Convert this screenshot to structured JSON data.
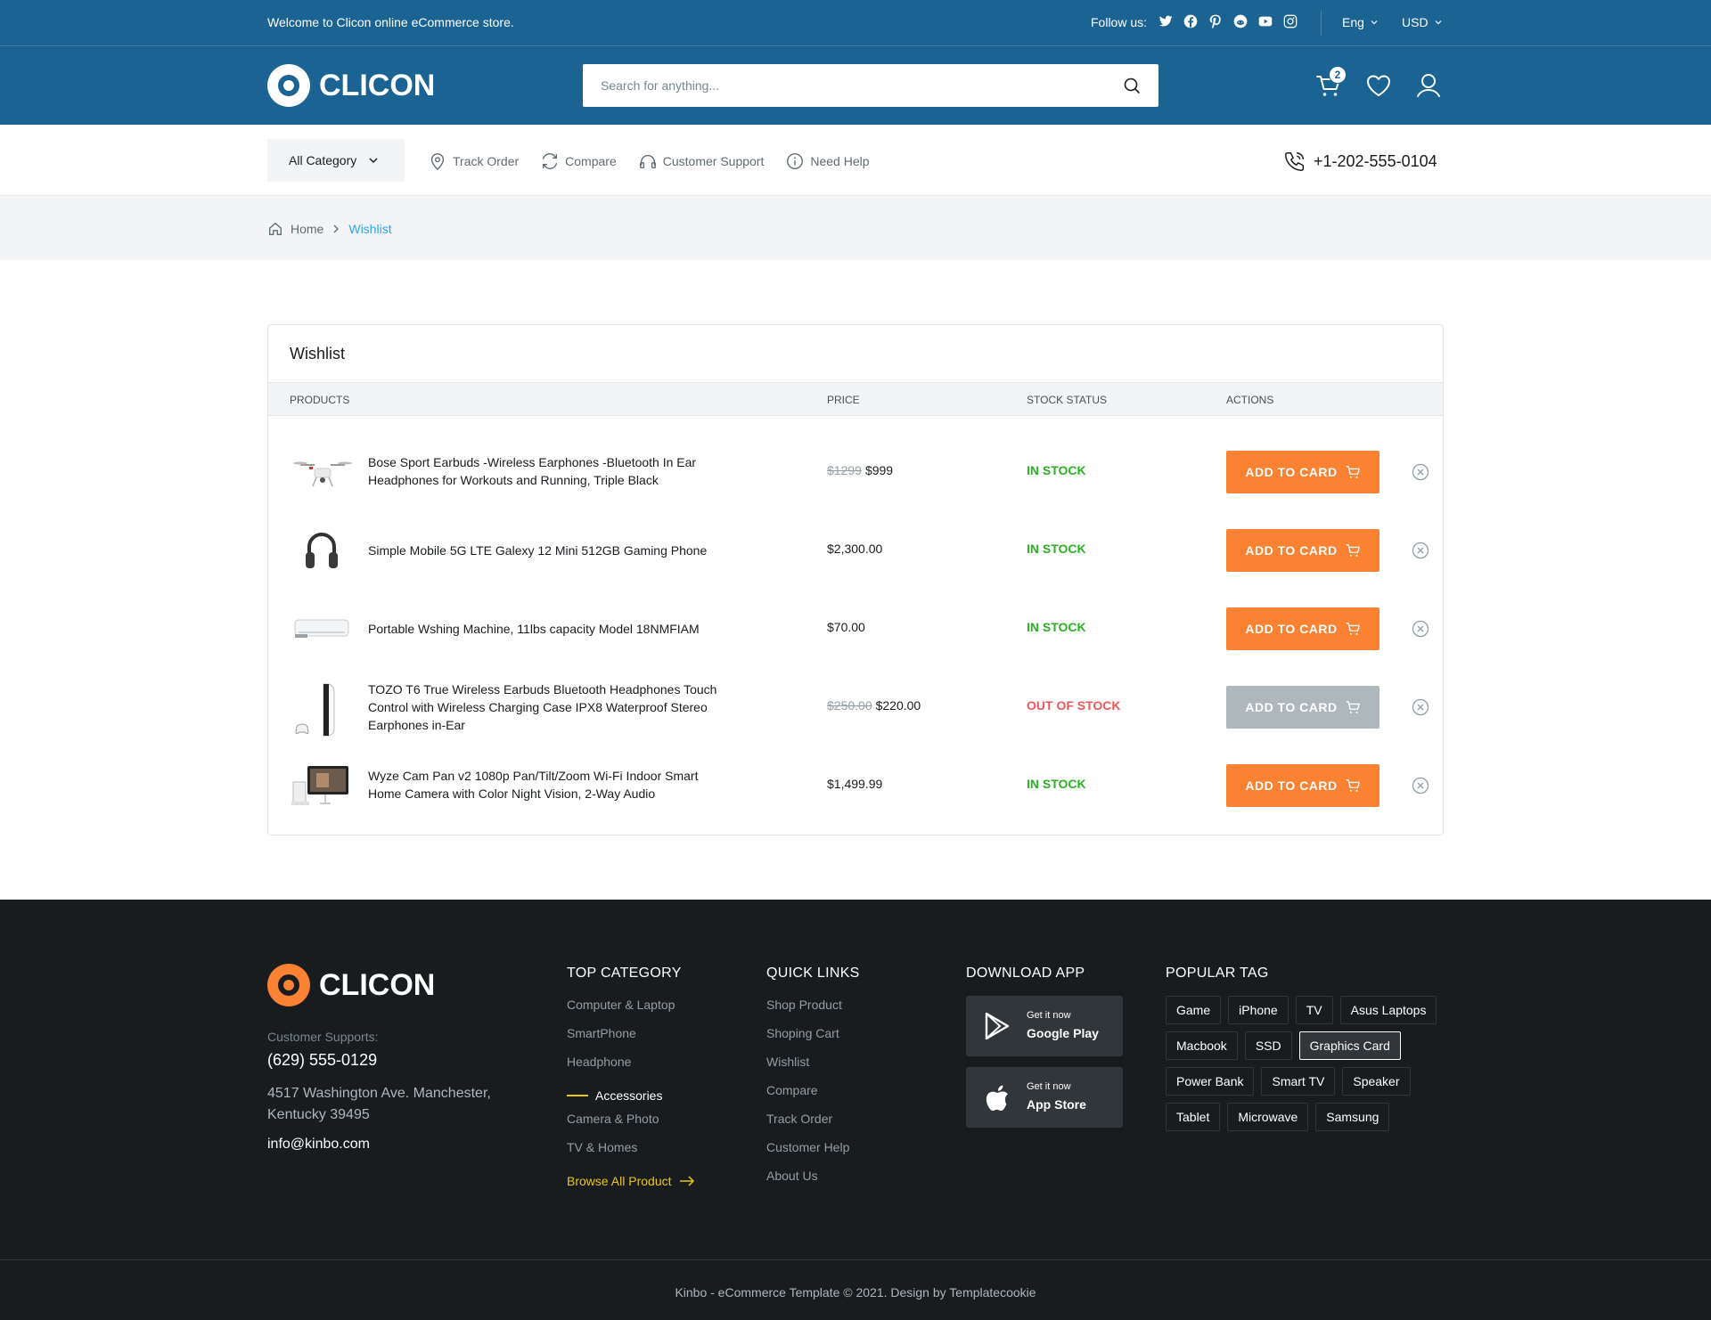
{
  "topbar": {
    "welcome": "Welcome to Clicon online eCommerce store.",
    "follow_label": "Follow us:",
    "social_icons": [
      "twitter-icon",
      "facebook-icon",
      "pinterest-icon",
      "reddit-icon",
      "youtube-icon",
      "instagram-icon"
    ],
    "language": "Eng",
    "currency": "USD"
  },
  "header": {
    "logo_text": "CLICON",
    "search_placeholder": "Search for anything...",
    "cart_count": "2"
  },
  "nav": {
    "all_category": "All Category",
    "links": [
      "Track Order",
      "Compare",
      "Customer Support",
      "Need Help"
    ],
    "phone": "+1-202-555-0104"
  },
  "breadcrumb": {
    "home": "Home",
    "current": "Wishlist"
  },
  "wishlist": {
    "title": "Wishlist",
    "headers": {
      "products": "PRODUCTS",
      "price": "PRICE",
      "stock": "STOCK STATUS",
      "actions": "ACTIONS"
    },
    "button_label": "ADD TO CARD",
    "items": [
      {
        "name": "Bose Sport Earbuds -Wireless Earphones -Bluetooth In Ear Headphones for Workouts and Running, Triple Black",
        "old_price": "$1299",
        "price": "$999",
        "stock": "IN STOCK",
        "image": "drone"
      },
      {
        "name": "Simple Mobile 5G LTE Galexy 12 Mini 512GB Gaming Phone",
        "old_price": "",
        "price": "$2,300.00",
        "stock": "IN STOCK",
        "image": "headphones"
      },
      {
        "name": "Portable Wshing Machine, 11lbs capacity Model 18NMFIAM",
        "old_price": "",
        "price": "$70.00",
        "stock": "IN STOCK",
        "image": "air-conditioner"
      },
      {
        "name": "TOZO T6 True Wireless Earbuds Bluetooth Headphones Touch Control with Wireless Charging Case IPX8 Waterproof Stereo Earphones in-Ear",
        "old_price": "$250.00",
        "price": "$220.00",
        "stock": "OUT OF STOCK",
        "image": "game-console"
      },
      {
        "name": "Wyze Cam Pan v2 1080p Pan/Tilt/Zoom Wi-Fi Indoor Smart Home Camera with Color Night Vision, 2-Way Audio",
        "old_price": "",
        "price": "$1,499.99",
        "stock": "IN STOCK",
        "image": "desktop-computer"
      }
    ]
  },
  "footer": {
    "logo_text": "CLICON",
    "support_label": "Customer Supports:",
    "phone": "(629) 555-0129",
    "address": "4517 Washington Ave. Manchester, Kentucky 39495",
    "email": "info@kinbo.com",
    "top_category": {
      "title": "TOP CATEGORY",
      "items": [
        "Computer & Laptop",
        "SmartPhone",
        "Headphone",
        "Accessories",
        "Camera & Photo",
        "TV & Homes"
      ],
      "browse": "Browse All Product"
    },
    "quick_links": {
      "title": "QUICK LINKS",
      "items": [
        "Shop Product",
        "Shoping Cart",
        "Wishlist",
        "Compare",
        "Track Order",
        "Customer Help",
        "About Us"
      ]
    },
    "download": {
      "title": "DOWNLOAD APP",
      "google_small": "Get it now",
      "google_big": "Google Play",
      "apple_small": "Get it now",
      "apple_big": "App Store"
    },
    "tags": {
      "title": "POPULAR TAG",
      "items": [
        "Game",
        "iPhone",
        "TV",
        "Asus Laptops",
        "Macbook",
        "SSD",
        "Graphics Card",
        "Power Bank",
        "Smart TV",
        "Speaker",
        "Tablet",
        "Microwave",
        "Samsung"
      ],
      "selected": "Graphics Card"
    },
    "copyright": "Kinbo - eCommerce Template © 2021. Design by Templatecookie"
  },
  "colors": {
    "brand": "#1b6392",
    "accent": "#fa8232",
    "in_stock": "#2db224",
    "out_stock": "#ee5858"
  }
}
